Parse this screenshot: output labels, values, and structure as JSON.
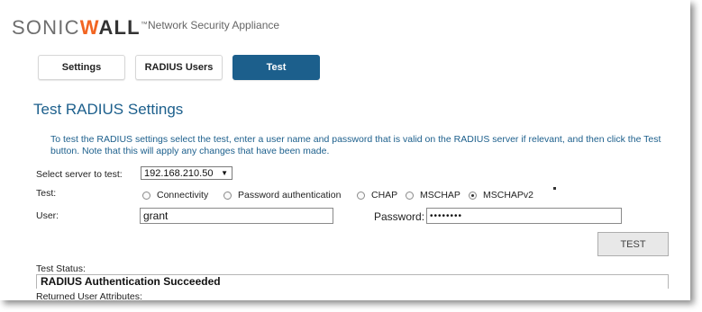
{
  "brand": {
    "logo_pre": "SONIC",
    "logo_post": "ALL",
    "logo_w": "W",
    "trademark": "™",
    "subtitle": "Network Security Appliance"
  },
  "tabs": [
    {
      "label": "Settings",
      "active": false
    },
    {
      "label": "RADIUS Users",
      "active": false
    },
    {
      "label": "Test",
      "active": true
    }
  ],
  "page": {
    "title": "Test RADIUS Settings",
    "description": "To test the RADIUS settings select the test, enter a user name and password that is valid on the RADIUS server if relevant, and then click the Test button. Note that this will apply any changes that have been made."
  },
  "form": {
    "server_label": "Select server to test:",
    "server_value": "192.168.210.50",
    "test_label": "Test:",
    "tests": [
      {
        "label": "Connectivity",
        "selected": false
      },
      {
        "label": "Password authentication",
        "selected": false
      },
      {
        "label": "CHAP",
        "selected": false
      },
      {
        "label": "MSCHAP",
        "selected": false
      },
      {
        "label": "MSCHAPv2",
        "selected": true
      }
    ],
    "user_label": "User:",
    "user_value": "grant",
    "password_label": "Password:",
    "password_value": "••••••••",
    "test_button": "TEST"
  },
  "status": {
    "label": "Test Status:",
    "value": "RADIUS Authentication Succeeded",
    "returned_label": "Returned User Attributes:"
  },
  "colors": {
    "accent": "#1c5f8c",
    "brand_orange": "#f26522"
  }
}
